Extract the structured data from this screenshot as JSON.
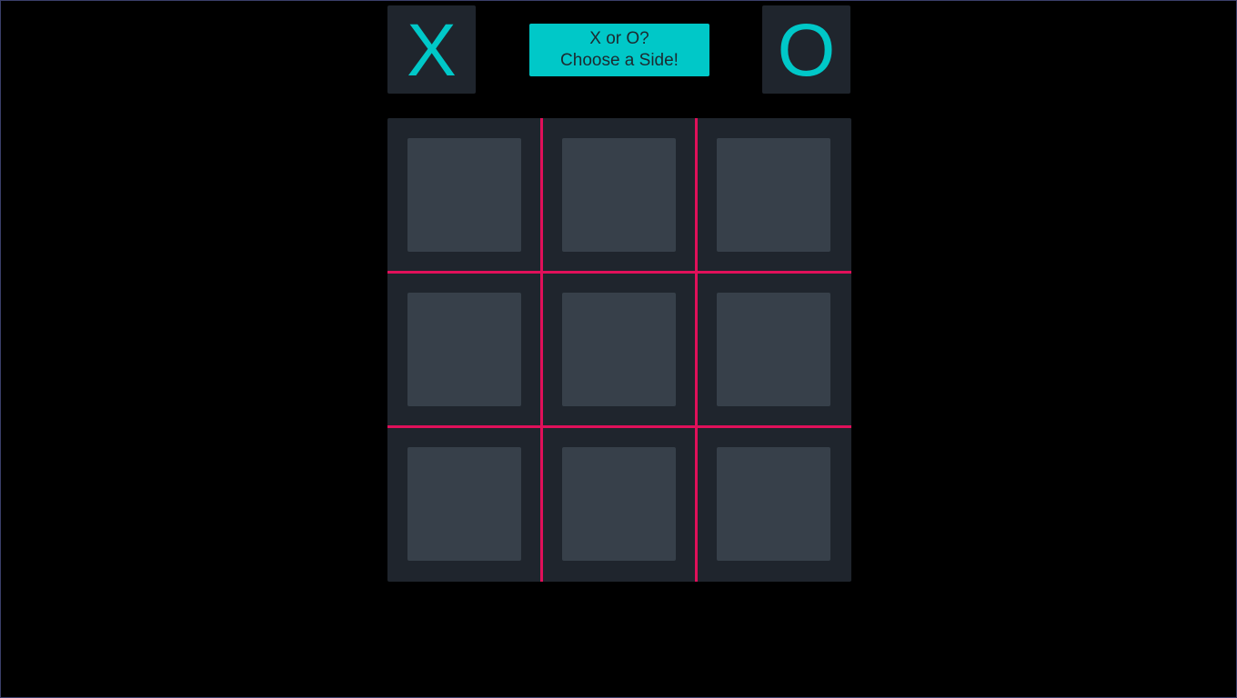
{
  "header": {
    "x_button_label": "X",
    "o_button_label": "O",
    "prompt_line1": "X or O?",
    "prompt_line2": "Choose a Side!"
  },
  "board": {
    "cells": [
      "",
      "",
      "",
      "",
      "",
      "",
      "",
      "",
      ""
    ]
  },
  "colors": {
    "accent": "#00c8c8",
    "grid_line": "#e0105a",
    "panel": "#1f252d",
    "tile": "#37404a",
    "background": "#000000"
  }
}
